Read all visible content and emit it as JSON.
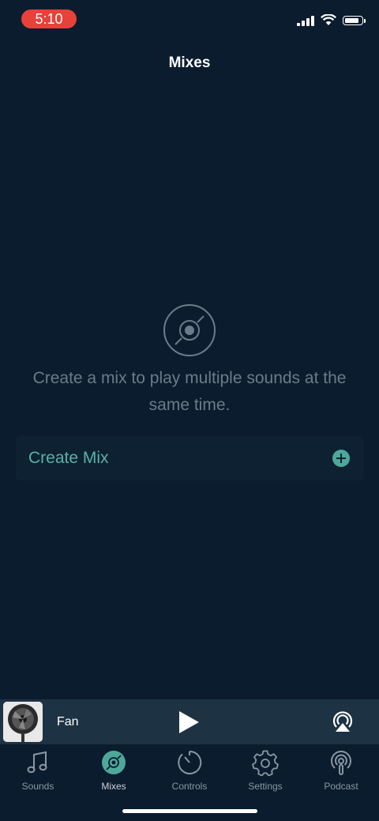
{
  "status_bar": {
    "time": "5:10"
  },
  "header": {
    "title": "Mixes"
  },
  "empty_state": {
    "icon": "disc-icon",
    "message": "Create a mix to play multiple sounds at the same time."
  },
  "create_mix": {
    "label": "Create Mix",
    "icon": "plus-circle-icon"
  },
  "player": {
    "track": "Fan",
    "play_icon": "play-icon",
    "airplay_icon": "airplay-icon"
  },
  "tabs": [
    {
      "label": "Sounds",
      "icon": "music-note-icon",
      "active": false
    },
    {
      "label": "Mixes",
      "icon": "disc-icon",
      "active": true
    },
    {
      "label": "Controls",
      "icon": "timer-icon",
      "active": false
    },
    {
      "label": "Settings",
      "icon": "gear-icon",
      "active": false
    },
    {
      "label": "Podcast",
      "icon": "podcast-icon",
      "active": false
    }
  ],
  "colors": {
    "background": "#0b1c2e",
    "accent": "#4ea89a",
    "player_bg": "#1d3243",
    "time_pill": "#e8413a"
  }
}
